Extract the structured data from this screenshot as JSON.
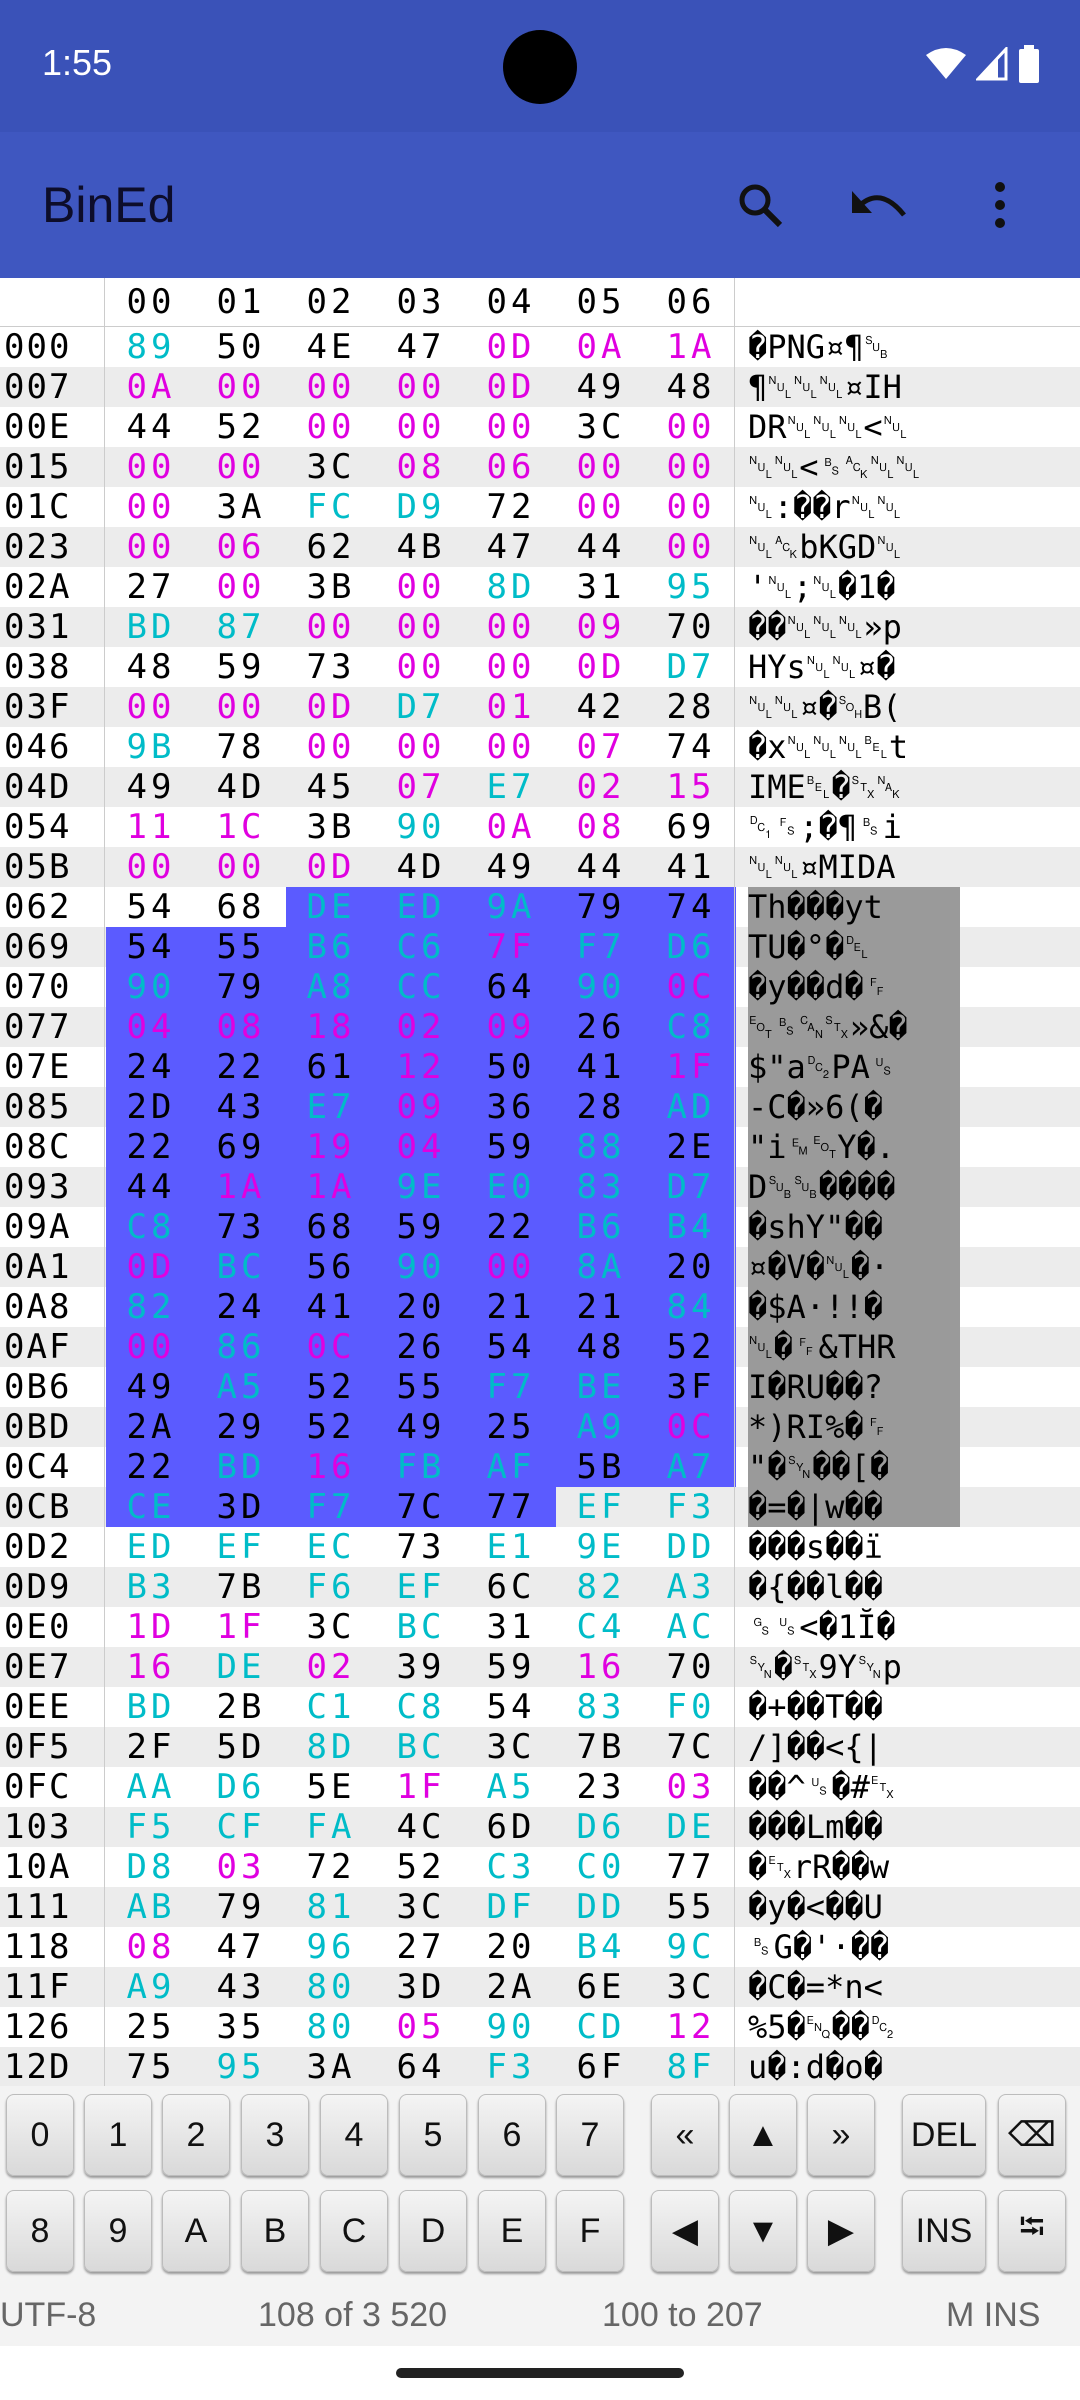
{
  "status_bar": {
    "time": "1:55"
  },
  "app_bar": {
    "title": "BinEd",
    "actions": [
      "search-icon",
      "undo-icon",
      "more-vert-icon"
    ]
  },
  "colors": {
    "primary": "#3f57c0",
    "selection": "#5b5bff",
    "zero": "#e000e0",
    "high": "#00bcc8",
    "normal": "#000000",
    "control": "#009977"
  },
  "header_columns": [
    "00",
    "01",
    "02",
    "03",
    "04",
    "05",
    "06"
  ],
  "rows": [
    {
      "addr": "000",
      "hex": [
        "89",
        "50",
        "4E",
        "47",
        "0D",
        "0A",
        "1A"
      ],
      "text": "�PNG¤¶␚"
    },
    {
      "addr": "007",
      "hex": [
        "0A",
        "00",
        "00",
        "00",
        "0D",
        "49",
        "48"
      ],
      "text": "¶␀␀␀¤IH"
    },
    {
      "addr": "00E",
      "hex": [
        "44",
        "52",
        "00",
        "00",
        "00",
        "3C",
        "00"
      ],
      "text": "DR␀␀␀<␀"
    },
    {
      "addr": "015",
      "hex": [
        "00",
        "00",
        "3C",
        "08",
        "06",
        "00",
        "00"
      ],
      "text": "␀␀<␈␆␀␀"
    },
    {
      "addr": "01C",
      "hex": [
        "00",
        "3A",
        "FC",
        "D9",
        "72",
        "00",
        "00"
      ],
      "text": "␀:��r␀␀"
    },
    {
      "addr": "023",
      "hex": [
        "00",
        "06",
        "62",
        "4B",
        "47",
        "44",
        "00"
      ],
      "text": "␀␆bKGD␀"
    },
    {
      "addr": "02A",
      "hex": [
        "27",
        "00",
        "3B",
        "00",
        "8D",
        "31",
        "95"
      ],
      "text": "'␀;␀�1�"
    },
    {
      "addr": "031",
      "hex": [
        "BD",
        "87",
        "00",
        "00",
        "00",
        "09",
        "70"
      ],
      "text": "��␀␀␀»p"
    },
    {
      "addr": "038",
      "hex": [
        "48",
        "59",
        "73",
        "00",
        "00",
        "0D",
        "D7"
      ],
      "text": "HYs␀␀¤�"
    },
    {
      "addr": "03F",
      "hex": [
        "00",
        "00",
        "0D",
        "D7",
        "01",
        "42",
        "28"
      ],
      "text": "␀␀¤�␁B("
    },
    {
      "addr": "046",
      "hex": [
        "9B",
        "78",
        "00",
        "00",
        "00",
        "07",
        "74"
      ],
      "text": "�x␀␀␀␇t"
    },
    {
      "addr": "04D",
      "hex": [
        "49",
        "4D",
        "45",
        "07",
        "E7",
        "02",
        "15"
      ],
      "text": "IME␇�␂␕"
    },
    {
      "addr": "054",
      "hex": [
        "11",
        "1C",
        "3B",
        "90",
        "0A",
        "08",
        "69"
      ],
      "text": "␑␜;�¶␈i"
    },
    {
      "addr": "05B",
      "hex": [
        "00",
        "00",
        "0D",
        "4D",
        "49",
        "44",
        "41"
      ],
      "text": "␀␀¤MIDA"
    },
    {
      "addr": "062",
      "hex": [
        "54",
        "68",
        "DE",
        "ED",
        "9A",
        "79",
        "74"
      ],
      "text": "Th���yt"
    },
    {
      "addr": "069",
      "hex": [
        "54",
        "55",
        "B6",
        "C6",
        "7F",
        "F7",
        "D6"
      ],
      "text": "TU�°�␡"
    },
    {
      "addr": "070",
      "hex": [
        "90",
        "79",
        "A8",
        "CC",
        "64",
        "90",
        "0C"
      ],
      "text": "�y��d�␌"
    },
    {
      "addr": "077",
      "hex": [
        "04",
        "08",
        "18",
        "02",
        "09",
        "26",
        "C8"
      ],
      "text": "␄␈␘␂»&�"
    },
    {
      "addr": "07E",
      "hex": [
        "24",
        "22",
        "61",
        "12",
        "50",
        "41",
        "1F"
      ],
      "text": "$\"a␒PA␟"
    },
    {
      "addr": "085",
      "hex": [
        "2D",
        "43",
        "E7",
        "09",
        "36",
        "28",
        "AD"
      ],
      "text": "-C�»6(�"
    },
    {
      "addr": "08C",
      "hex": [
        "22",
        "69",
        "19",
        "04",
        "59",
        "88",
        "2E"
      ],
      "text": "\"i␙␄Y�."
    },
    {
      "addr": "093",
      "hex": [
        "44",
        "1A",
        "1A",
        "9E",
        "E0",
        "83",
        "D7"
      ],
      "text": "D␚␚����"
    },
    {
      "addr": "09A",
      "hex": [
        "C8",
        "73",
        "68",
        "59",
        "22",
        "B6",
        "B4"
      ],
      "text": "�shY\"��"
    },
    {
      "addr": "0A1",
      "hex": [
        "0D",
        "BC",
        "56",
        "90",
        "00",
        "8A",
        "20"
      ],
      "text": "¤�V�␀�·"
    },
    {
      "addr": "0A8",
      "hex": [
        "82",
        "24",
        "41",
        "20",
        "21",
        "21",
        "84"
      ],
      "text": "�$A·!!�"
    },
    {
      "addr": "0AF",
      "hex": [
        "00",
        "86",
        "0C",
        "26",
        "54",
        "48",
        "52"
      ],
      "text": "␀�␌&THR"
    },
    {
      "addr": "0B6",
      "hex": [
        "49",
        "A5",
        "52",
        "55",
        "F7",
        "BE",
        "3F"
      ],
      "text": "I�RU��?"
    },
    {
      "addr": "0BD",
      "hex": [
        "2A",
        "29",
        "52",
        "49",
        "25",
        "A9",
        "0C"
      ],
      "text": "*)RI%�␌"
    },
    {
      "addr": "0C4",
      "hex": [
        "22",
        "BD",
        "16",
        "FB",
        "AF",
        "5B",
        "A7"
      ],
      "text": "\"�␖��[�"
    },
    {
      "addr": "0CB",
      "hex": [
        "CE",
        "3D",
        "F7",
        "7C",
        "77",
        "EF",
        "F3"
      ],
      "text": "�=�|w��"
    },
    {
      "addr": "0D2",
      "hex": [
        "ED",
        "EF",
        "EC",
        "73",
        "E1",
        "9E",
        "DD"
      ],
      "text": "���s��ï"
    },
    {
      "addr": "0D9",
      "hex": [
        "B3",
        "7B",
        "F6",
        "EF",
        "6C",
        "82",
        "A3"
      ],
      "text": "�{��l��"
    },
    {
      "addr": "0E0",
      "hex": [
        "1D",
        "1F",
        "3C",
        "BC",
        "31",
        "C4",
        "AC"
      ],
      "text": "␝␟<�1Ĭ�"
    },
    {
      "addr": "0E7",
      "hex": [
        "16",
        "DE",
        "02",
        "39",
        "59",
        "16",
        "70"
      ],
      "text": "␖�␂9Y␖p"
    },
    {
      "addr": "0EE",
      "hex": [
        "BD",
        "2B",
        "C1",
        "C8",
        "54",
        "83",
        "F0"
      ],
      "text": "�+��T��"
    },
    {
      "addr": "0F5",
      "hex": [
        "2F",
        "5D",
        "8D",
        "BC",
        "3C",
        "7B",
        "7C"
      ],
      "text": "/]��<{|"
    },
    {
      "addr": "0FC",
      "hex": [
        "AA",
        "D6",
        "5E",
        "1F",
        "A5",
        "23",
        "03"
      ],
      "text": "��^␟�#␃"
    },
    {
      "addr": "103",
      "hex": [
        "F5",
        "CF",
        "FA",
        "4C",
        "6D",
        "D6",
        "DE"
      ],
      "text": "���Lm��"
    },
    {
      "addr": "10A",
      "hex": [
        "D8",
        "03",
        "72",
        "52",
        "C3",
        "C0",
        "77"
      ],
      "text": "�␃rR��w"
    },
    {
      "addr": "111",
      "hex": [
        "AB",
        "79",
        "81",
        "3C",
        "DF",
        "DD",
        "55"
      ],
      "text": "�y�<��U"
    },
    {
      "addr": "118",
      "hex": [
        "08",
        "47",
        "96",
        "27",
        "20",
        "B4",
        "9C"
      ],
      "text": "␈G�'·��"
    },
    {
      "addr": "11F",
      "hex": [
        "A9",
        "43",
        "80",
        "3D",
        "2A",
        "6E",
        "3C"
      ],
      "text": "�C�=*n<"
    },
    {
      "addr": "126",
      "hex": [
        "25",
        "35",
        "80",
        "05",
        "90",
        "CD",
        "12"
      ],
      "text": "%5�␅��␒"
    },
    {
      "addr": "12D",
      "hex": [
        "75",
        "95",
        "3A",
        "64",
        "F3",
        "6F",
        "8F"
      ],
      "text": "u�:d�o�"
    }
  ],
  "keyboard": {
    "row1": [
      "0",
      "1",
      "2",
      "3",
      "4",
      "5",
      "6",
      "7",
      "«",
      "▲",
      "»",
      "DEL",
      "⌫"
    ],
    "row2": [
      "8",
      "9",
      "A",
      "B",
      "C",
      "D",
      "E",
      "F",
      "◀",
      "▼",
      "▶",
      "INS",
      "⭾"
    ]
  },
  "footer": {
    "encoding": "UTF-8",
    "position": "108 of 3 520",
    "selection": "100 to 207",
    "mode": "M INS"
  }
}
